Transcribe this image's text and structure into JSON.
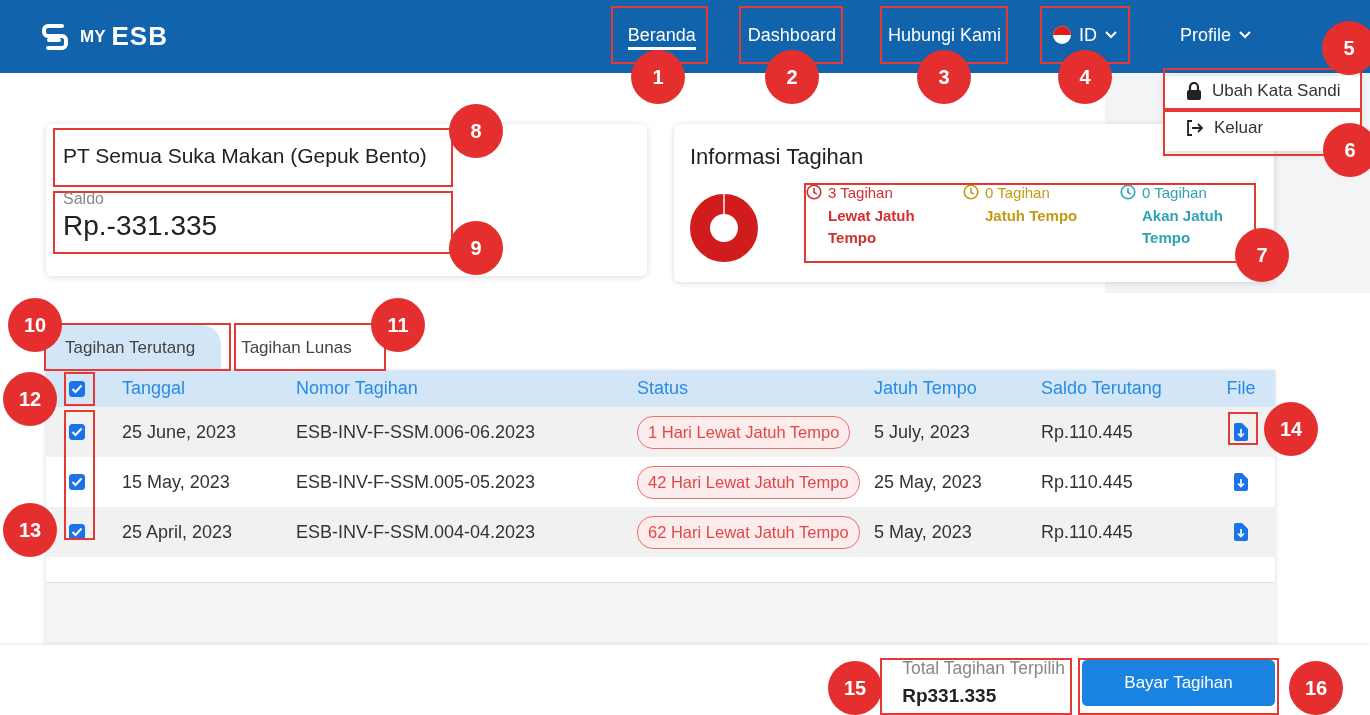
{
  "header": {
    "logo": {
      "prefix": "MY",
      "name": "ESB"
    },
    "nav": [
      {
        "label": "Beranda",
        "kind": "link",
        "selected": true
      },
      {
        "label": "Dashboard",
        "kind": "link",
        "selected": false
      },
      {
        "label": "Hubungi Kami",
        "kind": "link",
        "selected": false
      },
      {
        "label": "ID",
        "kind": "language",
        "selected": false
      },
      {
        "label": "Profile",
        "kind": "menu",
        "selected": false
      }
    ]
  },
  "profile_menu": {
    "items": [
      {
        "label": "Ubah Kata Sandi",
        "kind": "lock"
      },
      {
        "label": "Keluar",
        "kind": "logout"
      }
    ]
  },
  "company_card": {
    "name": "PT Semua Suka Makan (Gepuk Bento)",
    "balance_label": "Saldo",
    "balance": "Rp.-331.335"
  },
  "billing_info": {
    "title": "Informasi Tagihan",
    "items": [
      {
        "count": "3 Tagihan",
        "label": "Lewat Jatuh Tempo",
        "color": "#d32f2f"
      },
      {
        "count": "0 Tagihan",
        "label": "Jatuh Tempo",
        "color": "#c49a14"
      },
      {
        "count": "0 Tagihan",
        "label": "Akan Jatuh Tempo",
        "color": "#2fa3b5"
      }
    ]
  },
  "tabs": [
    {
      "label": "Tagihan Terutang",
      "selected": true
    },
    {
      "label": "Tagihan Lunas",
      "selected": false
    }
  ],
  "table": {
    "select_all": true,
    "columns": [
      "Tanggal",
      "Nomor Tagihan",
      "Status",
      "Jatuh Tempo",
      "Saldo Terutang",
      "File"
    ],
    "rows": [
      {
        "checked": true,
        "date": "25 June, 2023",
        "number": "ESB-INV-F-SSM.006-06.2023",
        "status": "1 Hari Lewat Jatuh Tempo",
        "due": "5 July, 2023",
        "balance": "Rp.110.445"
      },
      {
        "checked": true,
        "date": "15 May, 2023",
        "number": "ESB-INV-F-SSM.005-05.2023",
        "status": "42 Hari Lewat Jatuh Tempo",
        "due": "25 May, 2023",
        "balance": "Rp.110.445"
      },
      {
        "checked": true,
        "date": "25 April, 2023",
        "number": "ESB-INV-F-SSM.004-04.2023",
        "status": "62 Hari Lewat Jatuh Tempo",
        "due": "5 May, 2023",
        "balance": "Rp.110.445"
      }
    ]
  },
  "footer": {
    "total_label": "Total Tagihan Terpilih",
    "total": "Rp331.335",
    "pay_button": "Bayar Tagihan"
  },
  "callouts": [
    {
      "number": "1"
    },
    {
      "number": "2"
    },
    {
      "number": "3"
    },
    {
      "number": "4"
    },
    {
      "number": "5"
    },
    {
      "number": "6"
    },
    {
      "number": "7"
    },
    {
      "number": "8"
    },
    {
      "number": "9"
    },
    {
      "number": "10"
    },
    {
      "number": "11"
    },
    {
      "number": "12"
    },
    {
      "number": "13"
    },
    {
      "number": "14"
    },
    {
      "number": "15"
    },
    {
      "number": "16"
    }
  ]
}
